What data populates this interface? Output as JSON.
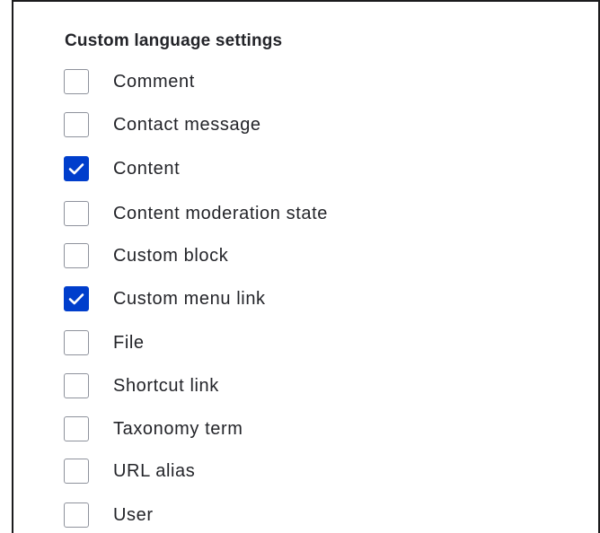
{
  "section": {
    "title": "Custom language settings"
  },
  "options": [
    {
      "label": "Comment",
      "checked": false
    },
    {
      "label": "Contact message",
      "checked": false
    },
    {
      "label": "Content",
      "checked": true
    },
    {
      "label": "Content moderation state",
      "checked": false
    },
    {
      "label": "Custom block",
      "checked": false
    },
    {
      "label": "Custom menu link",
      "checked": true
    },
    {
      "label": "File",
      "checked": false
    },
    {
      "label": "Shortcut link",
      "checked": false
    },
    {
      "label": "Taxonomy term",
      "checked": false
    },
    {
      "label": "URL alias",
      "checked": false
    },
    {
      "label": "User",
      "checked": false
    }
  ],
  "colors": {
    "checked_fill": "#003ecc",
    "unchecked_border": "#8e929c",
    "text": "#232429"
  }
}
